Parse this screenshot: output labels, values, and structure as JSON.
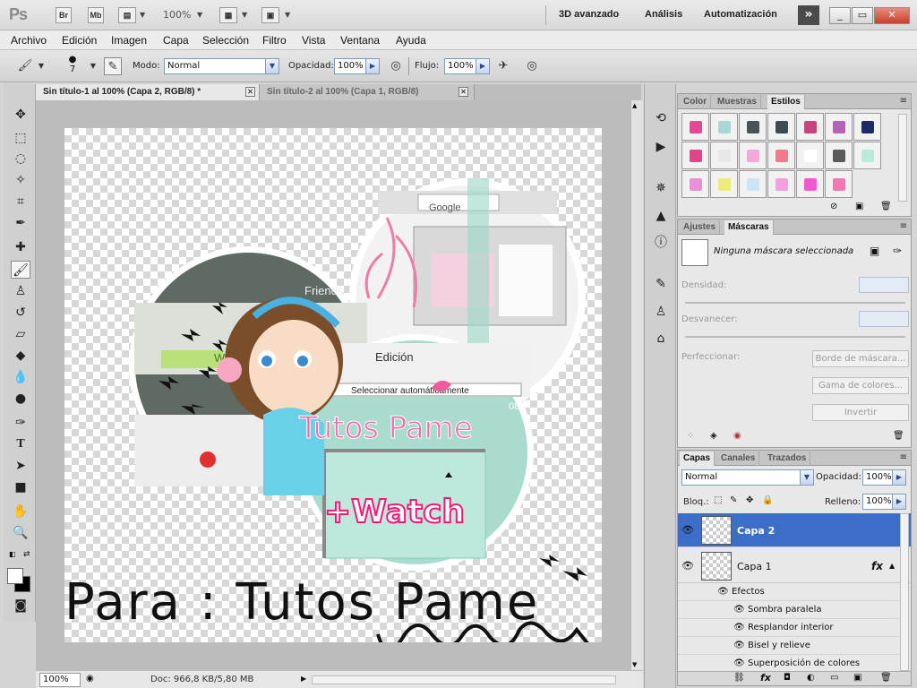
{
  "app": {
    "logo": "Ps",
    "bridge_label": "Br",
    "minibridge_label": "Mb",
    "zoom": "100%",
    "workspaces": [
      "3D avanzado",
      "Análisis",
      "Automatización"
    ],
    "more_label": "»",
    "window_buttons": [
      "_",
      "▭",
      "✕"
    ]
  },
  "menu": [
    "Archivo",
    "Edición",
    "Imagen",
    "Capa",
    "Selección",
    "Filtro",
    "Vista",
    "Ventana",
    "Ayuda"
  ],
  "options": {
    "brush_size": "7",
    "mode_label": "Modo:",
    "mode_value": "Normal",
    "opacity_label": "Opacidad:",
    "opacity_value": "100%",
    "flow_label": "Flujo:",
    "flow_value": "100%"
  },
  "tabs": [
    {
      "label": "Sin título-1 al 100% (Capa 2, RGB/8) *",
      "active": true
    },
    {
      "label": "Sin título-2 al 100% (Capa 1, RGB/8)",
      "active": false
    }
  ],
  "canvas": {
    "friends_label": "Friends",
    "watching_label": "Watching",
    "menu_edicion": "Edición",
    "select_label": "Seleccionar automáticamente",
    "google_label": "Google",
    "title_text": "Tutos Pame",
    "watch_text": "+Watch",
    "footer_text": "Para : Tutos Pame",
    "time_label": "08"
  },
  "status": {
    "zoom": "100%",
    "doc_info": "Doc: 966,8 KB/5,80 MB"
  },
  "styles_panel": {
    "tabs": [
      "Color",
      "Muestras",
      "Estilos"
    ],
    "active": "Estilos",
    "swatch_colors": [
      "#e44a8f",
      "#a8d8d2",
      "#4a5256",
      "#3d4a52",
      "#c8447a",
      "#b264b8",
      "#1a2a6a",
      "#e2448a",
      "#e8e8e8",
      "#f4a8d8",
      "#f07a8a",
      "#ffffff",
      "#5a5a5a",
      "#b8ecd8",
      "#e890d8",
      "#ecec7a",
      "#cde4f4",
      "#f4a0e0",
      "#f05ad0",
      "#f07ab0"
    ]
  },
  "masks_panel": {
    "tabs": [
      "Ajustes",
      "Máscaras"
    ],
    "active": "Máscaras",
    "none_label": "Ninguna máscara seleccionada",
    "density_label": "Densidad:",
    "feather_label": "Desvanecer:",
    "refine_label": "Perfeccionar:",
    "btn_mask_edge": "Borde de máscara...",
    "btn_color_range": "Gama de colores...",
    "btn_invert": "Invertir"
  },
  "layers_panel": {
    "tabs": [
      "Capas",
      "Canales",
      "Trazados"
    ],
    "active": "Capas",
    "blend_mode": "Normal",
    "opacity_label": "Opacidad:",
    "opacity_value": "100%",
    "lock_label": "Bloq.:",
    "fill_label": "Relleno:",
    "fill_value": "100%",
    "layers": [
      {
        "name": "Capa 2",
        "selected": true
      },
      {
        "name": "Capa 1",
        "selected": false
      }
    ],
    "fx_label": "fx",
    "effects_label": "Efectos",
    "effects": [
      "Sombra paralela",
      "Resplandor interior",
      "Bisel y relieve",
      "Superposición de colores"
    ]
  }
}
